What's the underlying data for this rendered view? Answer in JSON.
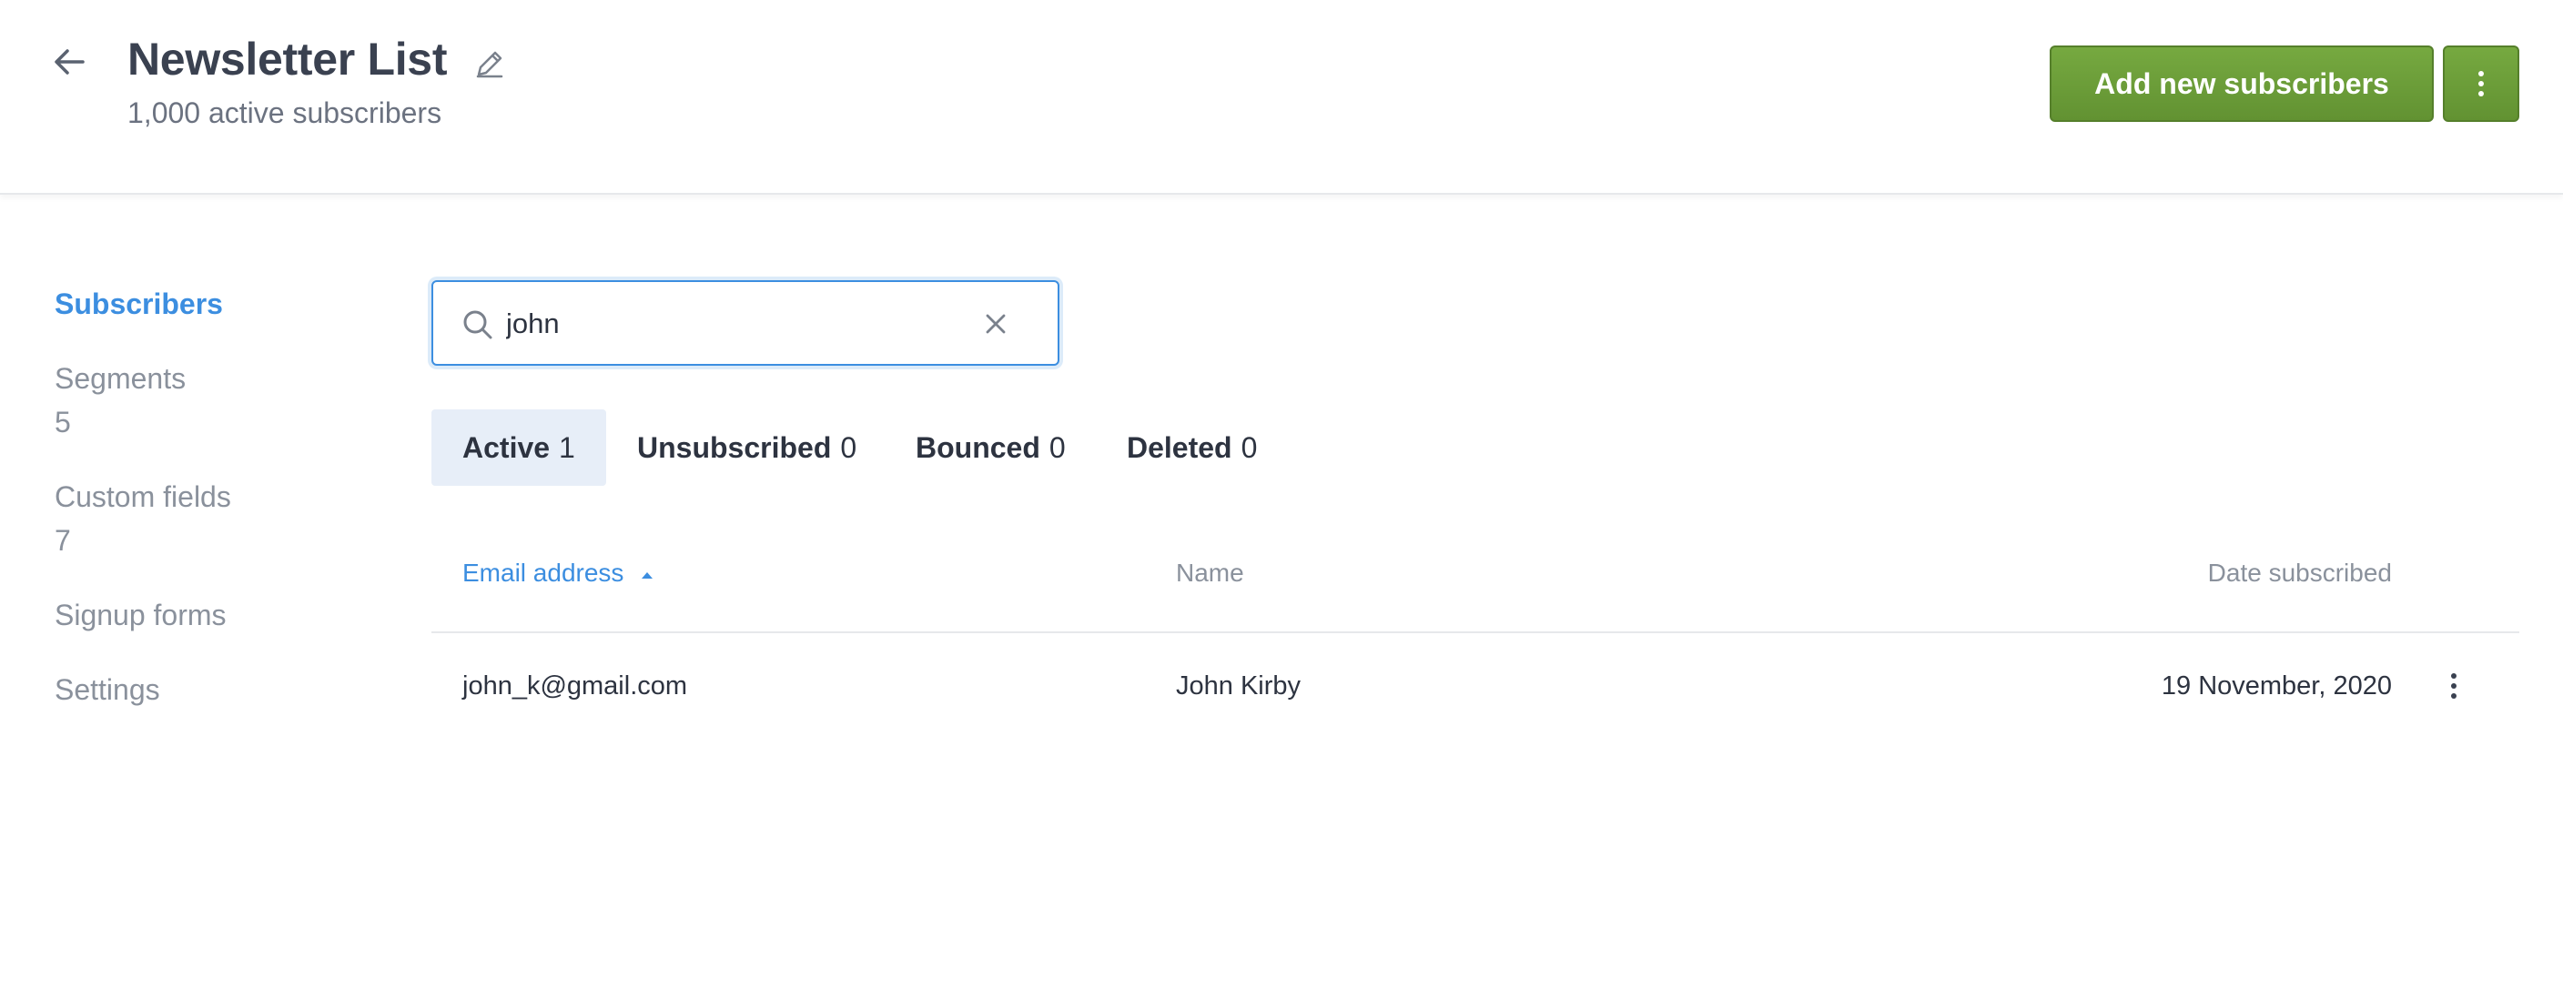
{
  "header": {
    "title": "Newsletter List",
    "subtitle": "1,000 active subscribers",
    "primary_button": "Add new subscribers"
  },
  "sidebar": {
    "items": [
      {
        "label": "Subscribers",
        "count": ""
      },
      {
        "label": "Segments",
        "count": "5"
      },
      {
        "label": "Custom fields",
        "count": "7"
      },
      {
        "label": "Signup forms",
        "count": ""
      },
      {
        "label": "Settings",
        "count": ""
      }
    ]
  },
  "search": {
    "value": "john",
    "placeholder": ""
  },
  "tabs": [
    {
      "label": "Active",
      "count": "1"
    },
    {
      "label": "Unsubscribed",
      "count": "0"
    },
    {
      "label": "Bounced",
      "count": "0"
    },
    {
      "label": "Deleted",
      "count": "0"
    }
  ],
  "table": {
    "columns": [
      "Email address",
      "Name",
      "Date subscribed"
    ],
    "rows": [
      {
        "email": "john_k@gmail.com",
        "name": "John Kirby",
        "date": "19 November, 2020"
      }
    ]
  },
  "colors": {
    "accent": "#3c8ee0",
    "primary_button": "#6a9b36",
    "text": "#3a4150",
    "muted": "#8a919c"
  },
  "icons": {
    "back": "arrow-left-icon",
    "edit": "pencil-icon",
    "more": "vertical-dots-icon",
    "search": "search-icon",
    "clear": "close-icon",
    "sort": "caret-up-icon"
  }
}
